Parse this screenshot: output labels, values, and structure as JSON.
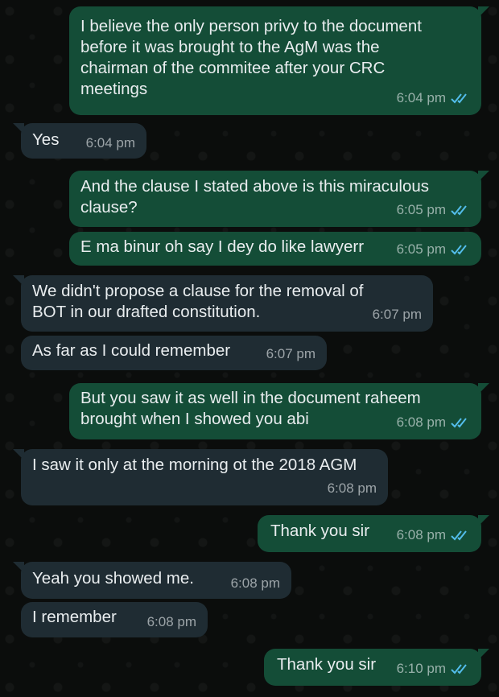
{
  "messages": [
    {
      "direction": "out",
      "text": "I believe the only person privy to the document\nbefore it was brought to the AgM was the\nchairman of the commitee after your CRC\nmeetings",
      "time": "6:04 pm",
      "read": true
    },
    {
      "direction": "in",
      "text": "Yes",
      "time": "6:04 pm"
    },
    {
      "direction": "out",
      "text": "And the clause I stated above is this miraculous\nclause?",
      "time": "6:05 pm",
      "read": true
    },
    {
      "direction": "out",
      "text": "E ma binur oh say I dey do like lawyerr",
      "time": "6:05 pm",
      "read": true
    },
    {
      "direction": "in",
      "text": "We didn't propose a clause for the removal of\nBOT in our drafted constitution.",
      "time": "6:07 pm"
    },
    {
      "direction": "in",
      "text": "As far as I could remember",
      "time": "6:07 pm"
    },
    {
      "direction": "out",
      "text": "But you saw it as well in the document raheem\nbrought when I showed you abi",
      "time": "6:08 pm",
      "read": true
    },
    {
      "direction": "in",
      "text": "I saw it only at the morning ot the 2018 AGM",
      "time": "6:08 pm"
    },
    {
      "direction": "out",
      "text": "Thank you sir",
      "time": "6:08 pm",
      "read": true
    },
    {
      "direction": "in",
      "text": "Yeah you showed me.",
      "time": "6:08 pm"
    },
    {
      "direction": "in",
      "text": "I remember",
      "time": "6:08 pm"
    },
    {
      "direction": "out",
      "text": "Thank you sir",
      "time": "6:10 pm",
      "read": true
    }
  ],
  "colors": {
    "outgoing_bubble": "#144d37",
    "incoming_bubble": "#1f2c33",
    "read_ticks": "#53bdeb",
    "background": "#0b0d0c"
  },
  "icons": {
    "read_receipt": "double-check-icon"
  }
}
